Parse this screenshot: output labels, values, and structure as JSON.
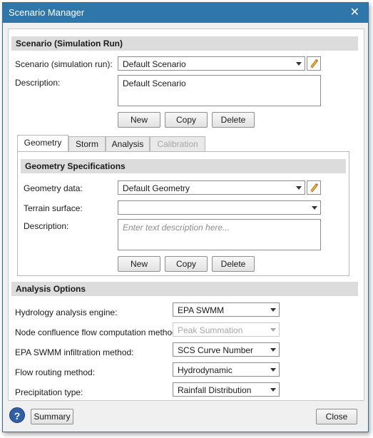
{
  "window": {
    "title": "Scenario Manager"
  },
  "scenario": {
    "header": "Scenario (Simulation Run)",
    "scenario_label": "Scenario (simulation run):",
    "scenario_value": "Default Scenario",
    "description_label": "Description:",
    "description_value": "Default Scenario",
    "buttons": {
      "new": "New",
      "copy": "Copy",
      "delete": "Delete"
    }
  },
  "tabs": [
    {
      "label": "Geometry",
      "state": "active"
    },
    {
      "label": "Storm",
      "state": "normal"
    },
    {
      "label": "Analysis",
      "state": "normal"
    },
    {
      "label": "Calibration",
      "state": "disabled"
    }
  ],
  "geometry": {
    "header": "Geometry Specifications",
    "geometry_label": "Geometry data:",
    "geometry_value": "Default Geometry",
    "terrain_label": "Terrain surface:",
    "terrain_value": "",
    "description_label": "Description:",
    "description_placeholder": "Enter text description here...",
    "buttons": {
      "new": "New",
      "copy": "Copy",
      "delete": "Delete"
    }
  },
  "analysis_options": {
    "header": "Analysis Options",
    "rows": [
      {
        "label": "Hydrology analysis engine:",
        "value": "EPA SWMM",
        "enabled": true
      },
      {
        "label": "Node confluence flow computation method:",
        "value": "Peak Summation",
        "enabled": false
      },
      {
        "label": "EPA SWMM infiltration method:",
        "value": "SCS Curve Number",
        "enabled": true
      },
      {
        "label": "Flow routing method:",
        "value": "Hydrodynamic",
        "enabled": true
      },
      {
        "label": "Precipitation type:",
        "value": "Rainfall Distribution",
        "enabled": true
      }
    ]
  },
  "footer": {
    "help_icon": "?",
    "summary": "Summary",
    "close": "Close"
  },
  "colors": {
    "titlebar": "#2f76ab",
    "section_header": "#dcdcdc",
    "help": "#2f5fa8"
  }
}
